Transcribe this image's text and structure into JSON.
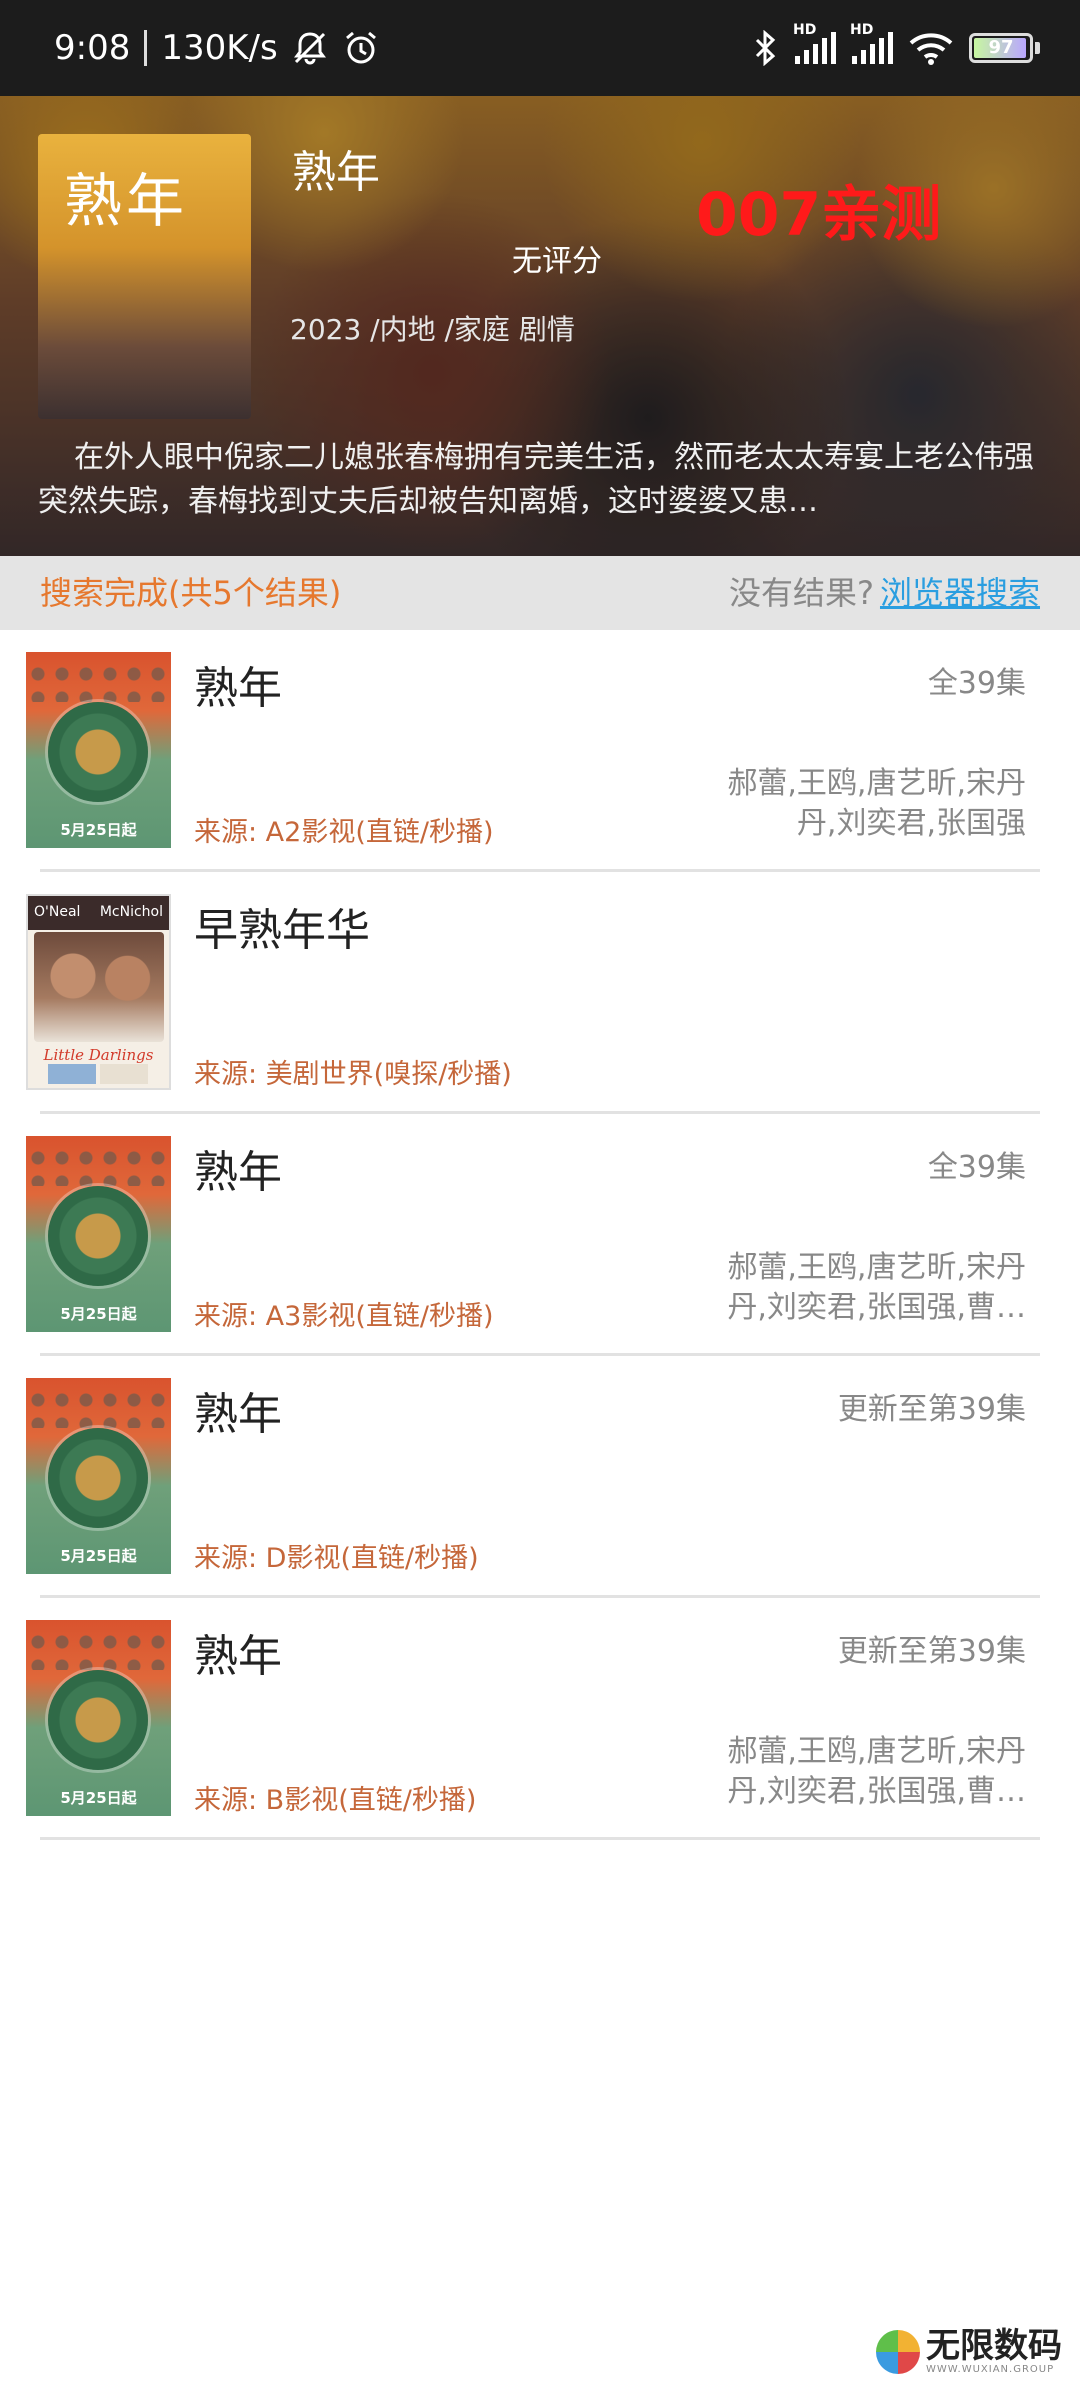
{
  "status_bar": {
    "time": "9:08",
    "speed": "130K/s",
    "icons": [
      "bell-off-icon",
      "alarm-icon",
      "bluetooth-icon",
      "signal-hd-icon",
      "signal-hd-icon",
      "wifi-icon"
    ],
    "hd_label": "HD",
    "battery_level": "97"
  },
  "header": {
    "title": "熟年",
    "watermark": "007亲测",
    "rating": "无评分",
    "meta": "2023 /内地 /家庭 剧情",
    "synopsis": "在外人眼中倪家二儿媳张春梅拥有完美生活，然而老太太寿宴上老公伟强突然失踪，春梅找到丈夫后却被告知离婚，这时婆婆又患…",
    "poster_title": "熟年"
  },
  "search_bar": {
    "result_text": "搜索完成(共5个结果)",
    "no_result_text": "没有结果?",
    "browser_search_label": "浏览器搜索"
  },
  "results": [
    {
      "title": "熟年",
      "episodes": "全39集",
      "source": "来源: A2影视(直链/秒播)",
      "cast": "郝蕾,王鸥,唐艺昕,宋丹丹,刘奕君,张国强",
      "poster_date": "5月25日起"
    },
    {
      "title": "早熟年华",
      "episodes": "",
      "source": "来源: 美剧世界(嗅探/秒播)",
      "cast": "",
      "poster_top_left": "O'Neal",
      "poster_top_right": "McNichol",
      "poster_title": "Little Darlings"
    },
    {
      "title": "熟年",
      "episodes": "全39集",
      "source": "来源: A3影视(直链/秒播)",
      "cast": "郝蕾,王鸥,唐艺昕,宋丹丹,刘奕君,张国强,曹…",
      "poster_date": "5月25日起"
    },
    {
      "title": "熟年",
      "episodes": "更新至第39集",
      "source": "来源: D影视(直链/秒播)",
      "cast": "",
      "poster_date": "5月25日起"
    },
    {
      "title": "熟年",
      "episodes": "更新至第39集",
      "source": "来源: B影视(直链/秒播)",
      "cast": "郝蕾,王鸥,唐艺昕,宋丹丹,刘奕君,张国强,曹…",
      "poster_date": "5月25日起"
    }
  ],
  "footer_logo": {
    "cn": "无限数码",
    "en": "WWW.WUXIAN.GROUP"
  },
  "colors": {
    "accent_orange": "#e6782e",
    "source_brown": "#c5673a",
    "link_blue": "#2a9ee0",
    "watermark_red": "#ff1a1a"
  }
}
